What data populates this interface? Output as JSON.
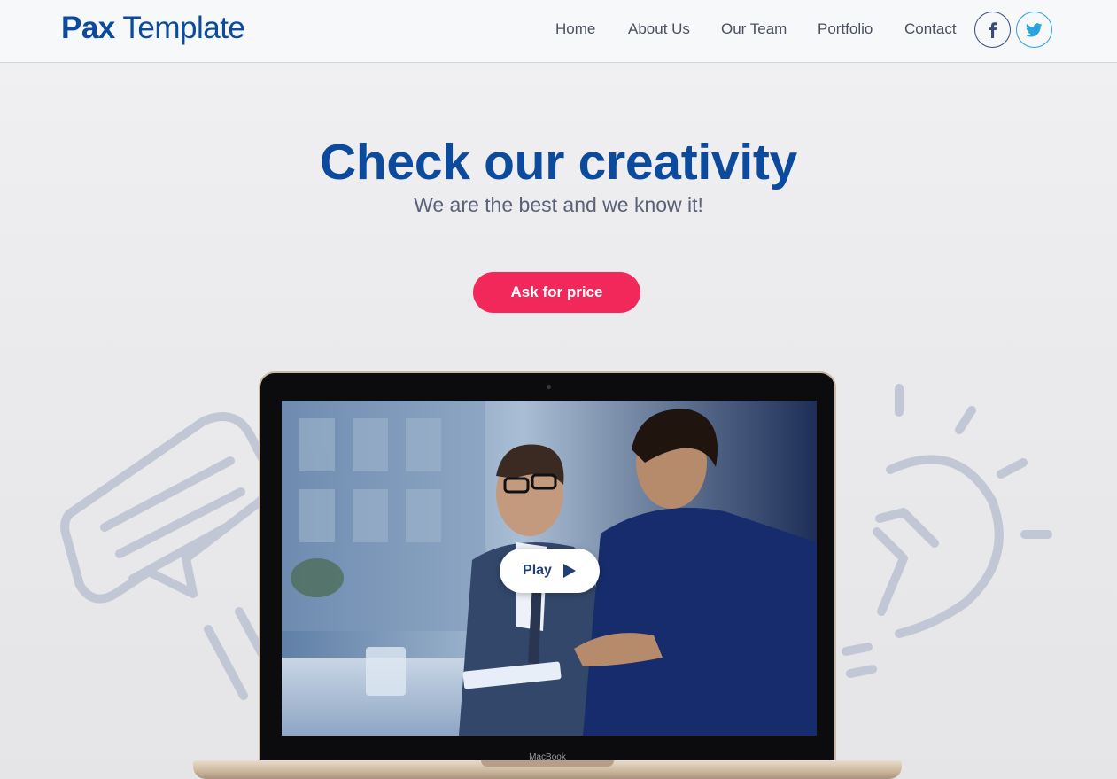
{
  "navbar": {
    "logo_bold": "Pax",
    "logo_light": "Template",
    "links": [
      "Home",
      "About Us",
      "Our Team",
      "Portfolio",
      "Contact"
    ],
    "social": [
      {
        "name": "facebook",
        "icon": "facebook-icon",
        "glyph": "f",
        "color": "#3a4a7a"
      },
      {
        "name": "twitter",
        "icon": "twitter-icon",
        "color": "#2aa3e0"
      }
    ]
  },
  "hero": {
    "title": "Check our creativity",
    "subtitle": "We are the best and we know it!",
    "cta_label": "Ask for price"
  },
  "video": {
    "play_label": "Play",
    "device_label": "MacBook"
  },
  "colors": {
    "brand_blue": "#0b4a9c",
    "cta_pink": "#f2285a",
    "deco_outline": "#c2c7d6"
  }
}
